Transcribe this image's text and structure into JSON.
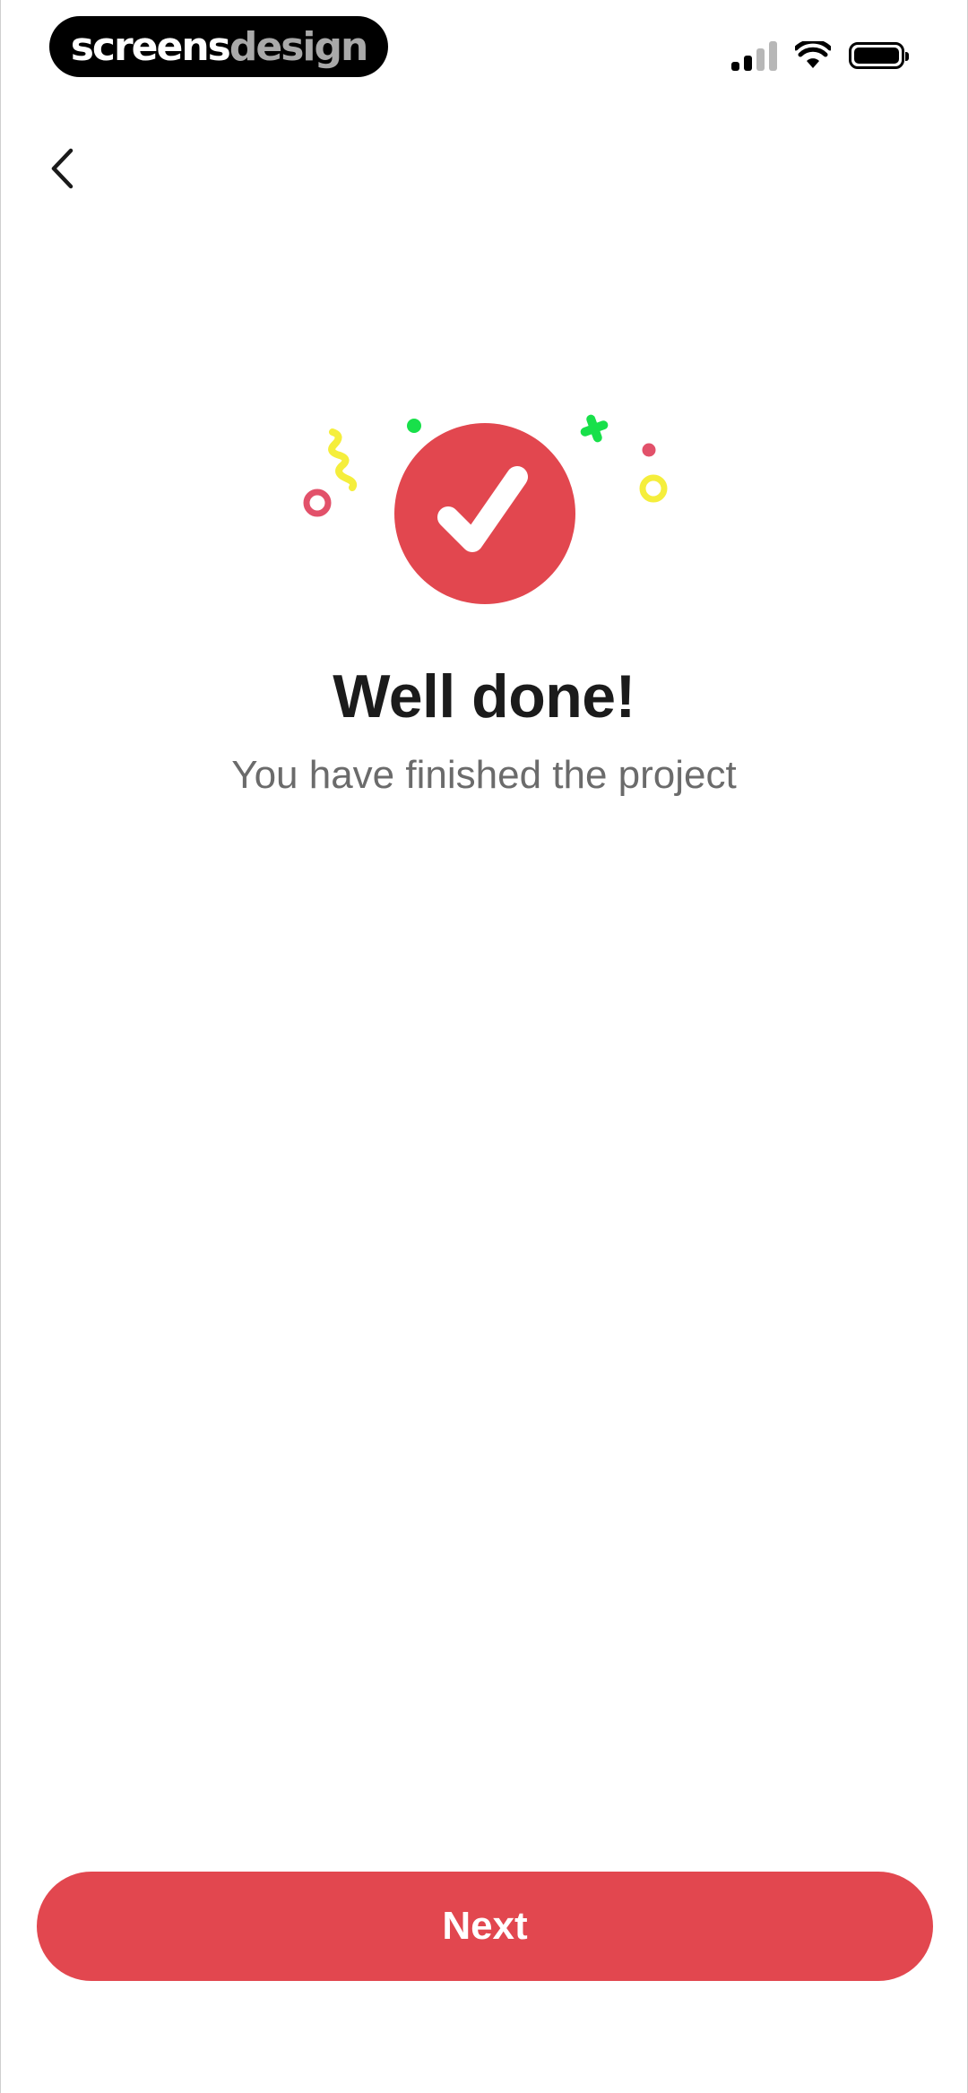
{
  "status_bar": {
    "brand_part1": "screens",
    "brand_part2": "design",
    "signal_icon": "cellular-signal-icon",
    "wifi_icon": "wifi-icon",
    "battery_icon": "battery-icon",
    "battery_level": 1.0
  },
  "nav": {
    "back_icon": "chevron-left-icon"
  },
  "illustration": {
    "badge_icon": "checkmark-icon",
    "badge_color": "#e2474f",
    "confetti_colors": [
      "#f5ee3c",
      "#18e04a",
      "#e2516a"
    ]
  },
  "content": {
    "title": "Well done!",
    "subtitle": "You have finished the project"
  },
  "actions": {
    "next_label": "Next",
    "accent_color": "#e2474f"
  }
}
